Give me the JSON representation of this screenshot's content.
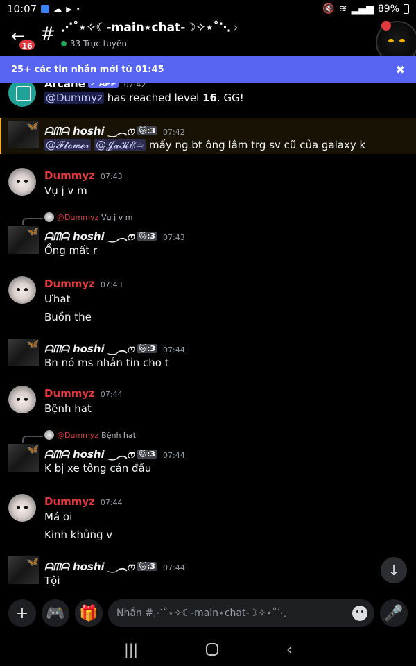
{
  "status_bar": {
    "time": "10:07",
    "battery": "89%"
  },
  "header": {
    "back_badge": "16",
    "channel_name": "⋰˚⋆✧☾-main⋆chat-☽✧⋆˚⋱",
    "online_count": "33 Trực tuyến"
  },
  "banner": {
    "text": "25+ các tin nhắn mới từ 01:45"
  },
  "messages": [
    {
      "author": "Arcane",
      "time": "07:42",
      "tag": "✓ APP",
      "mention": "@Dummyz",
      "text_before": " has reached level ",
      "level": "16",
      "text_after": ". GG!"
    },
    {
      "author": "ᗩᗰᗩ  hoshi ‿︵ෆ",
      "tag": "🐱:3",
      "time": "07:42",
      "mention1": "@𝓕𝓵𝓸𝔀𝓮𝓻",
      "mention2": "@𝓙𝓪𝓚𝓔☕",
      "text": " mấy ng bt ông lâm trg sv cũ của galaxy k"
    },
    {
      "author": "Dummyz",
      "time": "07:43",
      "text": "Vụ j v m"
    },
    {
      "reply_name": "@Dummyz",
      "reply_text": "Vụ j v m",
      "author": "ᗩᗰᗩ  hoshi ‿︵ෆ",
      "tag": "🐱:3",
      "time": "07:43",
      "text": "Ổng mất r"
    },
    {
      "author": "Dummyz",
      "time": "07:43",
      "text": "Ưhat",
      "text2": "Buồn the"
    },
    {
      "author": "ᗩᗰᗩ  hoshi ‿︵ෆ",
      "tag": "🐱:3",
      "time": "07:44",
      "text": "Bn nó ms nhắn tin cho t"
    },
    {
      "author": "Dummyz",
      "time": "07:44",
      "text": "Bệnh hat"
    },
    {
      "reply_name": "@Dummyz",
      "reply_text": "Bệnh hat",
      "author": "ᗩᗰᗩ  hoshi ‿︵ෆ",
      "tag": "🐱:3",
      "time": "07:44",
      "text": "K bị xe tông cán đầu"
    },
    {
      "author": "Dummyz",
      "time": "07:44",
      "text": "Má oi",
      "text2": "Kinh khủng v"
    },
    {
      "author": "ᗩᗰᗩ  hoshi ‿︵ෆ",
      "tag": "🐱:3",
      "time": "07:44",
      "text": "Tội"
    }
  ],
  "input": {
    "placeholder": "Nhắn #⋰˚⋆✧☾-main⋆chat-☽✧⋆˚⋱"
  },
  "icons": {
    "back": "arrow-left-icon",
    "add": "plus-icon",
    "game": "gamepad-icon",
    "gift": "gift-icon",
    "emoji": "emoji-icon",
    "mic": "microphone-icon",
    "scroll": "arrow-down-icon"
  },
  "colors": {
    "accent": "#5865f2",
    "dummyz_name": "#e0393e",
    "online": "#23a55a"
  }
}
